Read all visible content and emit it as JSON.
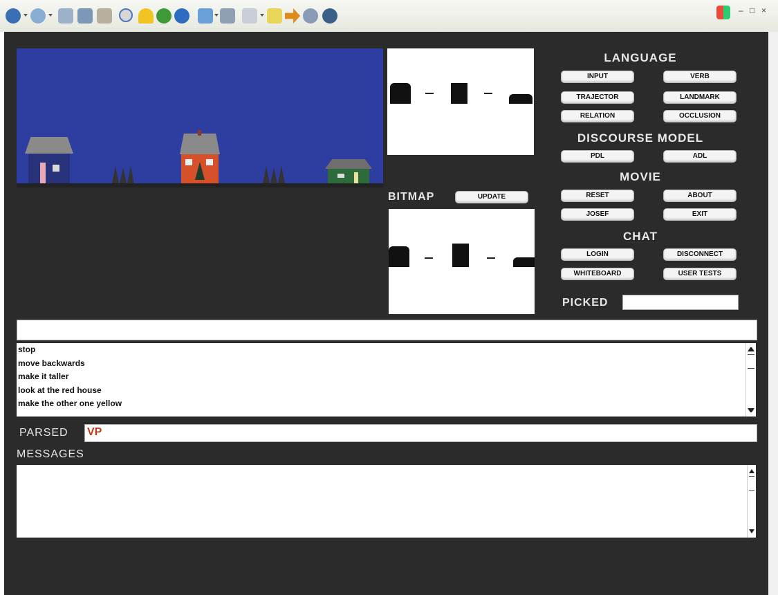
{
  "window": {
    "minimize": "–",
    "restore": "□",
    "close": "×"
  },
  "toolbar": {
    "icons": [
      "back-icon",
      "forward-icon",
      "stop-icon",
      "refresh-icon",
      "home-icon",
      "search-icon",
      "favorites-icon",
      "globe-icon",
      "history-icon",
      "mail-icon",
      "print-icon",
      "edit-icon",
      "note-icon",
      "arrow-icon",
      "messenger-icon",
      "media-icon"
    ],
    "colors": {
      "back": "#3a6fb3",
      "forward": "#7aa4cf",
      "green": "#3d9a36",
      "yellow": "#f2c423",
      "orange": "#e08a1a",
      "blue": "#2e6cbf"
    }
  },
  "bitmap_label": "BITMAP",
  "update_button": "UPDATE",
  "language": {
    "title": "LANGUAGE",
    "input": "INPUT",
    "verb": "VERB",
    "trajector": "TRAJECTOR",
    "landmark": "LANDMARK",
    "relation": "RELATION",
    "occlusion": "OCCLUSION"
  },
  "discourse": {
    "title": "DISCOURSE MODEL",
    "pdl": "PDL",
    "adl": "ADL"
  },
  "movie": {
    "title": "MOVIE",
    "reset": "RESET",
    "about": "ABOUT",
    "josef": "JOSEF",
    "exit": "EXIT"
  },
  "chat": {
    "title": "CHAT",
    "login": "LOGIN",
    "disconnect": "DISCONNECT",
    "whiteboard": "WHITEBOARD",
    "user_tests": "USER TESTS"
  },
  "picked": {
    "label": "PICKED",
    "value": ""
  },
  "command_input": {
    "value": ""
  },
  "history": [
    "stop",
    "move backwards",
    "make it taller",
    "look at the red house",
    "make the other one yellow"
  ],
  "parsed": {
    "label": "PARSED",
    "value": "VP"
  },
  "messages": {
    "label": "MESSAGES",
    "value": ""
  },
  "scene_colors": {
    "sky": "#2d3da0",
    "blue_house": "#27327a",
    "red_house": "#d6502a",
    "green_house": "#2e6b3a",
    "parsed_text": "#c0391b"
  }
}
